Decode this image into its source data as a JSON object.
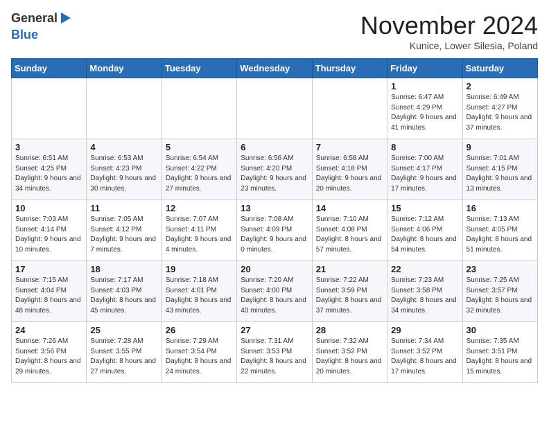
{
  "header": {
    "logo_general": "General",
    "logo_blue": "Blue",
    "month_title": "November 2024",
    "location": "Kunice, Lower Silesia, Poland"
  },
  "days_of_week": [
    "Sunday",
    "Monday",
    "Tuesday",
    "Wednesday",
    "Thursday",
    "Friday",
    "Saturday"
  ],
  "weeks": [
    [
      {
        "day": "",
        "sunrise": "",
        "sunset": "",
        "daylight": ""
      },
      {
        "day": "",
        "sunrise": "",
        "sunset": "",
        "daylight": ""
      },
      {
        "day": "",
        "sunrise": "",
        "sunset": "",
        "daylight": ""
      },
      {
        "day": "",
        "sunrise": "",
        "sunset": "",
        "daylight": ""
      },
      {
        "day": "",
        "sunrise": "",
        "sunset": "",
        "daylight": ""
      },
      {
        "day": "1",
        "sunrise": "Sunrise: 6:47 AM",
        "sunset": "Sunset: 4:29 PM",
        "daylight": "Daylight: 9 hours and 41 minutes."
      },
      {
        "day": "2",
        "sunrise": "Sunrise: 6:49 AM",
        "sunset": "Sunset: 4:27 PM",
        "daylight": "Daylight: 9 hours and 37 minutes."
      }
    ],
    [
      {
        "day": "3",
        "sunrise": "Sunrise: 6:51 AM",
        "sunset": "Sunset: 4:25 PM",
        "daylight": "Daylight: 9 hours and 34 minutes."
      },
      {
        "day": "4",
        "sunrise": "Sunrise: 6:53 AM",
        "sunset": "Sunset: 4:23 PM",
        "daylight": "Daylight: 9 hours and 30 minutes."
      },
      {
        "day": "5",
        "sunrise": "Sunrise: 6:54 AM",
        "sunset": "Sunset: 4:22 PM",
        "daylight": "Daylight: 9 hours and 27 minutes."
      },
      {
        "day": "6",
        "sunrise": "Sunrise: 6:56 AM",
        "sunset": "Sunset: 4:20 PM",
        "daylight": "Daylight: 9 hours and 23 minutes."
      },
      {
        "day": "7",
        "sunrise": "Sunrise: 6:58 AM",
        "sunset": "Sunset: 4:18 PM",
        "daylight": "Daylight: 9 hours and 20 minutes."
      },
      {
        "day": "8",
        "sunrise": "Sunrise: 7:00 AM",
        "sunset": "Sunset: 4:17 PM",
        "daylight": "Daylight: 9 hours and 17 minutes."
      },
      {
        "day": "9",
        "sunrise": "Sunrise: 7:01 AM",
        "sunset": "Sunset: 4:15 PM",
        "daylight": "Daylight: 9 hours and 13 minutes."
      }
    ],
    [
      {
        "day": "10",
        "sunrise": "Sunrise: 7:03 AM",
        "sunset": "Sunset: 4:14 PM",
        "daylight": "Daylight: 9 hours and 10 minutes."
      },
      {
        "day": "11",
        "sunrise": "Sunrise: 7:05 AM",
        "sunset": "Sunset: 4:12 PM",
        "daylight": "Daylight: 9 hours and 7 minutes."
      },
      {
        "day": "12",
        "sunrise": "Sunrise: 7:07 AM",
        "sunset": "Sunset: 4:11 PM",
        "daylight": "Daylight: 9 hours and 4 minutes."
      },
      {
        "day": "13",
        "sunrise": "Sunrise: 7:08 AM",
        "sunset": "Sunset: 4:09 PM",
        "daylight": "Daylight: 9 hours and 0 minutes."
      },
      {
        "day": "14",
        "sunrise": "Sunrise: 7:10 AM",
        "sunset": "Sunset: 4:08 PM",
        "daylight": "Daylight: 8 hours and 57 minutes."
      },
      {
        "day": "15",
        "sunrise": "Sunrise: 7:12 AM",
        "sunset": "Sunset: 4:06 PM",
        "daylight": "Daylight: 8 hours and 54 minutes."
      },
      {
        "day": "16",
        "sunrise": "Sunrise: 7:13 AM",
        "sunset": "Sunset: 4:05 PM",
        "daylight": "Daylight: 8 hours and 51 minutes."
      }
    ],
    [
      {
        "day": "17",
        "sunrise": "Sunrise: 7:15 AM",
        "sunset": "Sunset: 4:04 PM",
        "daylight": "Daylight: 8 hours and 48 minutes."
      },
      {
        "day": "18",
        "sunrise": "Sunrise: 7:17 AM",
        "sunset": "Sunset: 4:03 PM",
        "daylight": "Daylight: 8 hours and 45 minutes."
      },
      {
        "day": "19",
        "sunrise": "Sunrise: 7:18 AM",
        "sunset": "Sunset: 4:01 PM",
        "daylight": "Daylight: 8 hours and 43 minutes."
      },
      {
        "day": "20",
        "sunrise": "Sunrise: 7:20 AM",
        "sunset": "Sunset: 4:00 PM",
        "daylight": "Daylight: 8 hours and 40 minutes."
      },
      {
        "day": "21",
        "sunrise": "Sunrise: 7:22 AM",
        "sunset": "Sunset: 3:59 PM",
        "daylight": "Daylight: 8 hours and 37 minutes."
      },
      {
        "day": "22",
        "sunrise": "Sunrise: 7:23 AM",
        "sunset": "Sunset: 3:58 PM",
        "daylight": "Daylight: 8 hours and 34 minutes."
      },
      {
        "day": "23",
        "sunrise": "Sunrise: 7:25 AM",
        "sunset": "Sunset: 3:57 PM",
        "daylight": "Daylight: 8 hours and 32 minutes."
      }
    ],
    [
      {
        "day": "24",
        "sunrise": "Sunrise: 7:26 AM",
        "sunset": "Sunset: 3:56 PM",
        "daylight": "Daylight: 8 hours and 29 minutes."
      },
      {
        "day": "25",
        "sunrise": "Sunrise: 7:28 AM",
        "sunset": "Sunset: 3:55 PM",
        "daylight": "Daylight: 8 hours and 27 minutes."
      },
      {
        "day": "26",
        "sunrise": "Sunrise: 7:29 AM",
        "sunset": "Sunset: 3:54 PM",
        "daylight": "Daylight: 8 hours and 24 minutes."
      },
      {
        "day": "27",
        "sunrise": "Sunrise: 7:31 AM",
        "sunset": "Sunset: 3:53 PM",
        "daylight": "Daylight: 8 hours and 22 minutes."
      },
      {
        "day": "28",
        "sunrise": "Sunrise: 7:32 AM",
        "sunset": "Sunset: 3:52 PM",
        "daylight": "Daylight: 8 hours and 20 minutes."
      },
      {
        "day": "29",
        "sunrise": "Sunrise: 7:34 AM",
        "sunset": "Sunset: 3:52 PM",
        "daylight": "Daylight: 8 hours and 17 minutes."
      },
      {
        "day": "30",
        "sunrise": "Sunrise: 7:35 AM",
        "sunset": "Sunset: 3:51 PM",
        "daylight": "Daylight: 8 hours and 15 minutes."
      }
    ]
  ]
}
